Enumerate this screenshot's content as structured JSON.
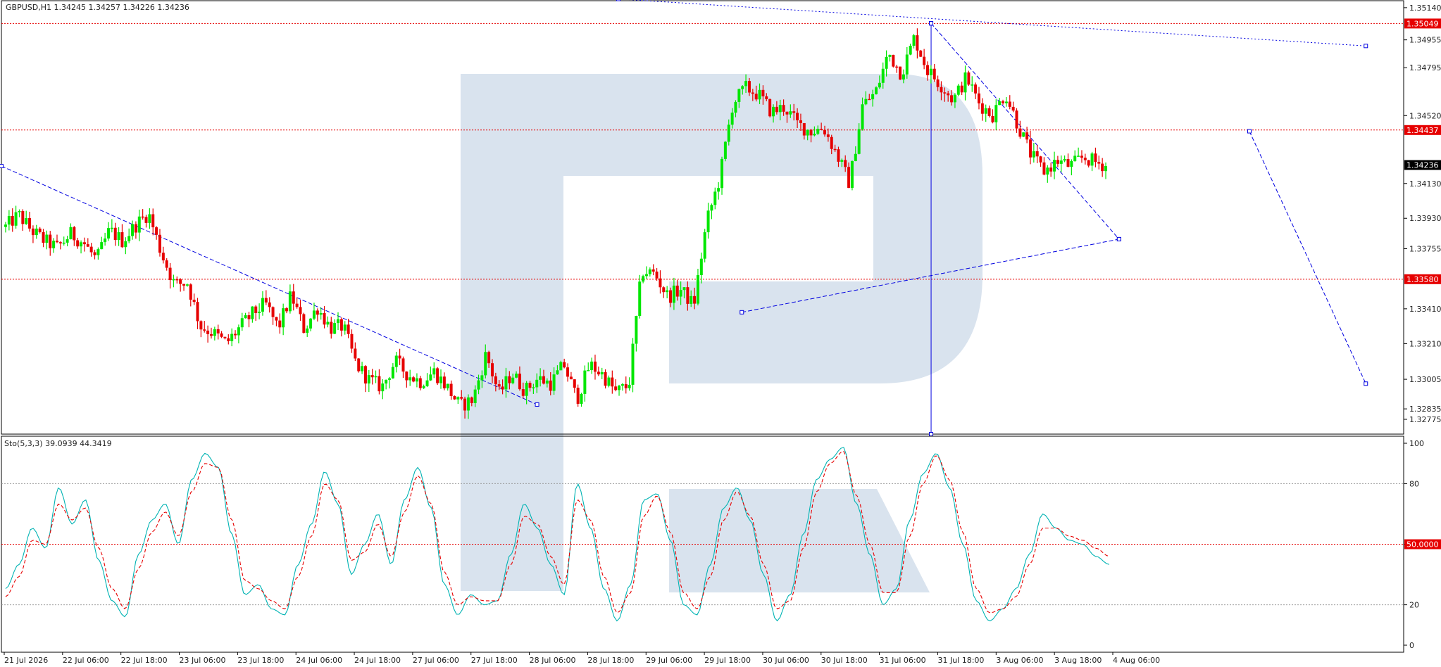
{
  "main_title": "GBPUSD,H1  1.34245 1.34257 1.34226 1.34236",
  "sub_title": "Sto(5,3,3) 39.0939 44.3419",
  "colors": {
    "bull": "#00e600",
    "bear": "#e60000",
    "stoch_main": "#00b3b3",
    "stoch_signal": "#e60000",
    "level": "#e60000",
    "trend": "#0000e0",
    "watermark": "#d6e0ec"
  },
  "chart_data": [
    {
      "type": "candlestick",
      "symbol": "GBPUSD",
      "timeframe": "H1",
      "ohlc_header": "1.34245 1.34257 1.34226 1.34236",
      "ylim": [
        1.3269,
        1.3518
      ],
      "y_ticks": [
        "1.35140",
        "1.34955",
        "1.34795",
        "1.34520",
        "1.34130",
        "1.33930",
        "1.33755",
        "1.33410",
        "1.33210",
        "1.33005",
        "1.32835",
        "1.32775"
      ],
      "tick_values": [
        1.3514,
        1.34955,
        1.34795,
        1.3452,
        1.3413,
        1.3393,
        1.33755,
        1.3341,
        1.3321,
        1.33005,
        1.32835,
        1.32775
      ],
      "x_labels": [
        "21 Jul 2026",
        "22 Jul 06:00",
        "22 Jul 18:00",
        "23 Jul 06:00",
        "23 Jul 18:00",
        "24 Jul 06:00",
        "24 Jul 18:00",
        "27 Jul 06:00",
        "27 Jul 18:00",
        "28 Jul 06:00",
        "28 Jul 18:00",
        "29 Jul 06:00",
        "29 Jul 18:00",
        "30 Jul 06:00",
        "30 Jul 18:00",
        "31 Jul 06:00",
        "31 Jul 18:00",
        "3 Aug 06:00",
        "3 Aug 18:00",
        "4 Aug 06:00"
      ],
      "levels": [
        {
          "value": 1.35049,
          "label": "1.35049"
        },
        {
          "value": 1.34437,
          "label": "1.34437"
        },
        {
          "value": 1.3358,
          "label": "1.33580"
        }
      ],
      "current_price": {
        "value": 1.34236,
        "label": "1.34236"
      },
      "path": [
        1.3388,
        1.3395,
        1.3386,
        1.338,
        1.3376,
        1.3384,
        1.3379,
        1.3369,
        1.3386,
        1.338,
        1.3389,
        1.3396,
        1.3373,
        1.3355,
        1.3356,
        1.3331,
        1.3327,
        1.3321,
        1.333,
        1.3338,
        1.3344,
        1.333,
        1.3349,
        1.3329,
        1.3342,
        1.333,
        1.3331,
        1.3309,
        1.33,
        1.3296,
        1.3311,
        1.3303,
        1.3299,
        1.3305,
        1.3296,
        1.3285,
        1.3289,
        1.3315,
        1.3292,
        1.3304,
        1.3294,
        1.3301,
        1.3298,
        1.3309,
        1.3289,
        1.3309,
        1.3303,
        1.3293,
        1.3297,
        1.3363,
        1.3361,
        1.3348,
        1.3352,
        1.3343,
        1.3391,
        1.3416,
        1.3459,
        1.3468,
        1.3464,
        1.3454,
        1.3457,
        1.3447,
        1.3443,
        1.3445,
        1.343,
        1.3413,
        1.3458,
        1.3465,
        1.3488,
        1.3476,
        1.3497,
        1.3478,
        1.347,
        1.3461,
        1.3474,
        1.3459,
        1.3452,
        1.3465,
        1.3446,
        1.3429,
        1.342,
        1.3426,
        1.3423,
        1.3428,
        1.3425,
        1.3423
      ],
      "trendlines": [
        {
          "name": "downtrend-left",
          "from": [
            0,
            1.3423
          ],
          "to": [
            0.382,
            1.3286
          ]
        },
        {
          "name": "triangle-lower",
          "from": [
            0.528,
            1.3339
          ],
          "to": [
            0.797,
            1.3381
          ]
        },
        {
          "name": "triangle-upper",
          "from": [
            0.663,
            1.3505
          ],
          "to": [
            0.797,
            1.3381
          ]
        },
        {
          "name": "triangle-vertical",
          "from": [
            0.663,
            1.3505
          ],
          "to": [
            0.663,
            1.3269
          ]
        },
        {
          "name": "top-channel",
          "from": [
            0.44,
            1.3519
          ],
          "to": [
            0.973,
            1.3492
          ]
        },
        {
          "name": "forecast",
          "from": [
            0.89,
            1.3443
          ],
          "to": [
            0.973,
            1.3298
          ]
        }
      ]
    },
    {
      "type": "line",
      "indicator": "Stochastic",
      "params": "5,3,3",
      "main_value": "39.0939",
      "signal_value": "44.3419",
      "ylim": [
        0,
        100
      ],
      "y_ticks": [
        "100",
        "80",
        "50.0000",
        "20",
        "0"
      ],
      "levels": [
        80,
        50,
        20
      ],
      "main_path": [
        28,
        40,
        58,
        48,
        78,
        60,
        72,
        42,
        22,
        14,
        45,
        62,
        70,
        50,
        82,
        95,
        88,
        55,
        25,
        30,
        18,
        15,
        40,
        60,
        86,
        70,
        35,
        50,
        65,
        40,
        72,
        88,
        68,
        30,
        15,
        25,
        20,
        22,
        45,
        70,
        58,
        40,
        25,
        80,
        58,
        28,
        12,
        30,
        72,
        75,
        52,
        20,
        15,
        40,
        68,
        78,
        62,
        35,
        12,
        25,
        55,
        82,
        92,
        98,
        70,
        45,
        20,
        28,
        62,
        85,
        95,
        78,
        50,
        22,
        12,
        18,
        28,
        45,
        65,
        58,
        52,
        50,
        44,
        40
      ],
      "signal_path": [
        24,
        34,
        52,
        50,
        70,
        62,
        68,
        48,
        28,
        18,
        38,
        56,
        66,
        54,
        76,
        90,
        88,
        62,
        32,
        28,
        22,
        18,
        34,
        54,
        80,
        72,
        42,
        46,
        60,
        44,
        66,
        84,
        70,
        36,
        20,
        24,
        22,
        22,
        40,
        64,
        60,
        44,
        30,
        72,
        62,
        34,
        16,
        26,
        64,
        74,
        56,
        26,
        18,
        34,
        62,
        76,
        64,
        40,
        18,
        22,
        48,
        76,
        90,
        96,
        74,
        50,
        26,
        26,
        54,
        80,
        94,
        82,
        56,
        28,
        16,
        18,
        24,
        40,
        58,
        58,
        54,
        52,
        48,
        44
      ]
    }
  ]
}
